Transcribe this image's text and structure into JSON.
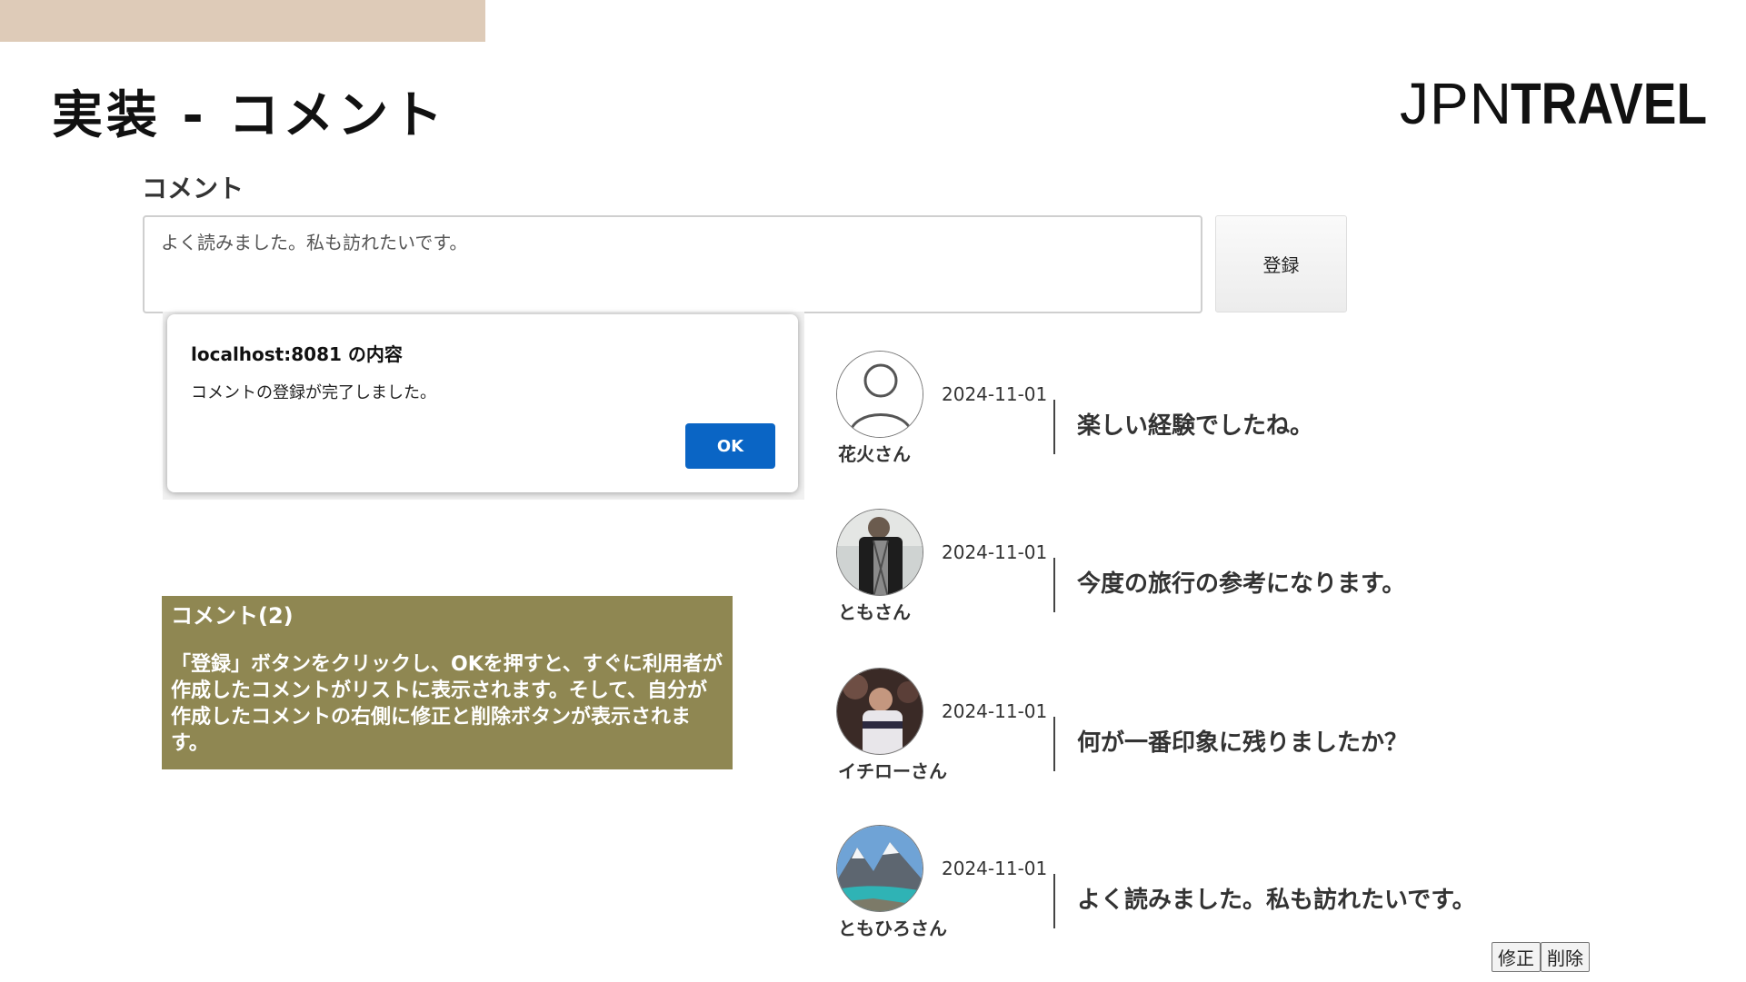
{
  "slide": {
    "title": "実装 - コメント",
    "logo_thin": "JPN",
    "logo_bold": "TRAVEL",
    "accent_color": "#decbb8"
  },
  "comment_form": {
    "label": "コメント",
    "value": "よく読みました。私も訪れたいです。",
    "register_label": "登録"
  },
  "dialog": {
    "title": "localhost:8081 の内容",
    "message": "コメントの登録が完了しました。",
    "ok_label": "OK"
  },
  "note": {
    "title": "コメント(2)",
    "body": "「登録」ボタンをクリックし、OKを押すと、すぐに利用者が作成したコメントがリストに表示されます。そして、自分が作成したコメントの右側に修正と削除ボタンが表示されます。",
    "color": "#8f8752"
  },
  "comments": [
    {
      "user": "花火さん",
      "date": "2024-11-01",
      "text": "楽しい経験でしたね。",
      "avatar": "default-user-icon"
    },
    {
      "user": "ともさん",
      "date": "2024-11-01",
      "text": "今度の旅行の参考になります。",
      "avatar": "person-photo"
    },
    {
      "user": "イチローさん",
      "date": "2024-11-01",
      "text": "何が一番印象に残りましたか？",
      "avatar": "baseball-player-photo"
    },
    {
      "user": "ともひろさん",
      "date": "2024-11-01",
      "text": "よく読みました。私も訪れたいです。",
      "avatar": "mountain-lake-photo"
    }
  ],
  "own_comment_actions": {
    "edit_label": "修正",
    "delete_label": "削除"
  },
  "colors": {
    "ok_button": "#0a65c5"
  }
}
